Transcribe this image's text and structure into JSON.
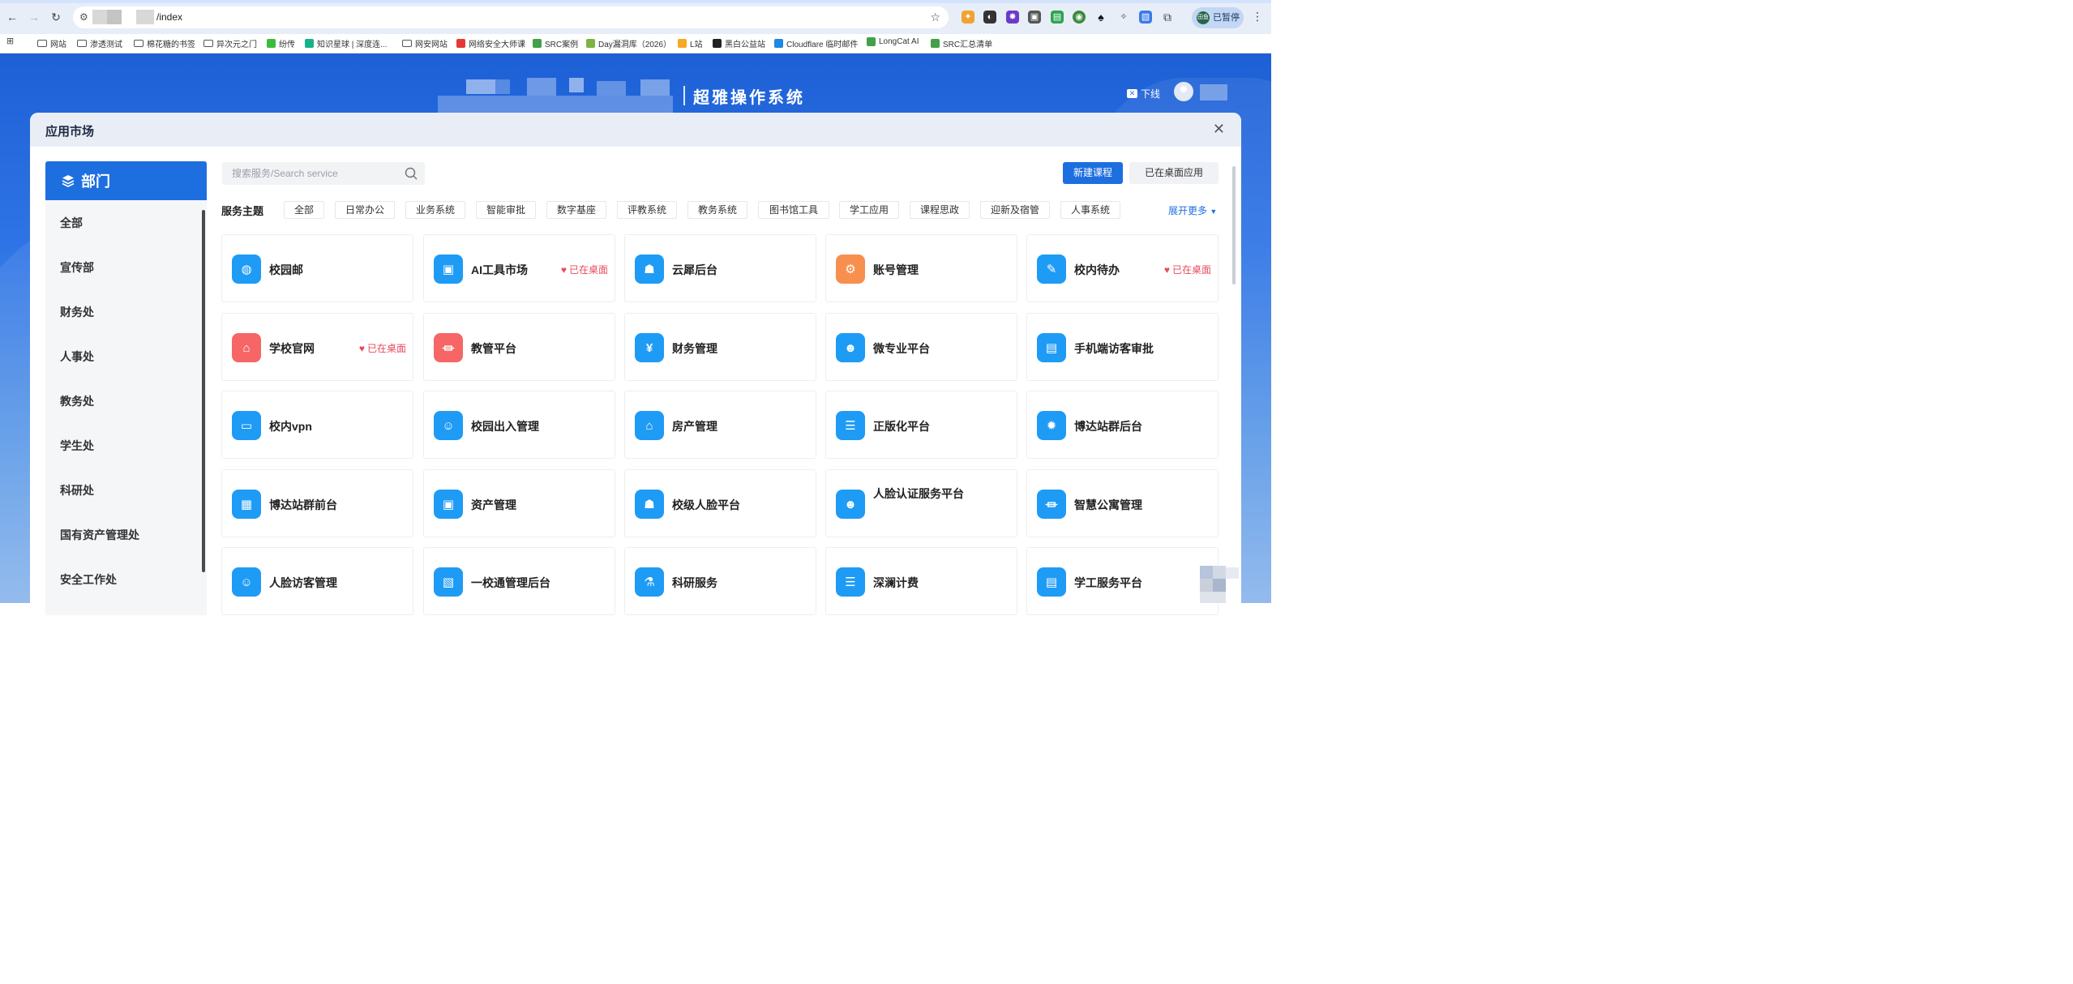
{
  "browser": {
    "url": "/index",
    "bookmarks": [
      {
        "label": "网站",
        "kind": "folder"
      },
      {
        "label": "渗透测试",
        "kind": "folder"
      },
      {
        "label": "棉花糖的书签",
        "kind": "folder"
      },
      {
        "label": "异次元之门",
        "kind": "folder"
      },
      {
        "label": "纷传",
        "kind": "site",
        "color": "#3dbb3d"
      },
      {
        "label": "知识星球 | 深度连...",
        "kind": "site",
        "color": "#16b28a"
      },
      {
        "label": "网安网站",
        "kind": "folder"
      },
      {
        "label": "网络安全大师课",
        "kind": "site",
        "color": "#e53935"
      },
      {
        "label": "SRC案例",
        "kind": "site",
        "color": "#43a047"
      },
      {
        "label": "Day漏洞库（2026）",
        "kind": "site",
        "color": "#7cb342"
      },
      {
        "label": "L站",
        "kind": "site",
        "color": "#f9a825"
      },
      {
        "label": "黑白公益站",
        "kind": "site",
        "color": "#222222"
      },
      {
        "label": "Cloudflare 临时邮件",
        "kind": "site",
        "color": "#1e88e5"
      },
      {
        "label": "LongCat AI",
        "kind": "site",
        "color": "#43a047"
      },
      {
        "label": "SRC汇总清单",
        "kind": "site",
        "color": "#43a047"
      }
    ],
    "profile_status": "已暂停",
    "profile_initials": "田鱼"
  },
  "header": {
    "system_title": "超雅操作系统",
    "logout_label": "下线"
  },
  "modal": {
    "title": "应用市场",
    "close_label": "✕"
  },
  "departments": {
    "title": "部门",
    "items": [
      "全部",
      "宣传部",
      "财务处",
      "人事处",
      "教务处",
      "学生处",
      "科研处",
      "国有资产管理处",
      "安全工作处"
    ]
  },
  "search": {
    "placeholder": "搜索服务/Search service"
  },
  "actions": {
    "new_course": "新建课程",
    "desktop_apps": "已在桌面应用"
  },
  "themes": {
    "label": "服务主题",
    "tags": [
      "全部",
      "日常办公",
      "业务系统",
      "智能审批",
      "数字基座",
      "评教系统",
      "教务系统",
      "图书馆工具",
      "学工应用",
      "课程思政",
      "迎新及宿管",
      "人事系统"
    ],
    "expand_label": "展开更多"
  },
  "desktop_badge": "已在桌面",
  "apps": [
    {
      "name": "校园邮",
      "icon": "globe-icon",
      "glyph": "◍",
      "color": "blue",
      "on_desktop": false
    },
    {
      "name": "AI工具市场",
      "icon": "toolbox-icon",
      "glyph": "▣",
      "color": "blue",
      "on_desktop": true
    },
    {
      "name": "云犀后台",
      "icon": "robot-icon",
      "glyph": "☗",
      "color": "blue",
      "on_desktop": false
    },
    {
      "name": "账号管理",
      "icon": "account-gear-icon",
      "glyph": "⚙",
      "color": "orange",
      "on_desktop": false
    },
    {
      "name": "校内待办",
      "icon": "todo-edit-icon",
      "glyph": "✎",
      "color": "blue",
      "on_desktop": true
    },
    {
      "name": "学校官网",
      "icon": "home-icon",
      "glyph": "⌂",
      "color": "red",
      "on_desktop": true
    },
    {
      "name": "教管平台",
      "icon": "institution-icon",
      "glyph": "⏛",
      "color": "red",
      "on_desktop": false
    },
    {
      "name": "财务管理",
      "icon": "money-bag-icon",
      "glyph": "¥",
      "color": "blue",
      "on_desktop": false
    },
    {
      "name": "微专业平台",
      "icon": "user-desk-icon",
      "glyph": "☻",
      "color": "blue",
      "on_desktop": false
    },
    {
      "name": "手机端访客审批",
      "icon": "document-icon",
      "glyph": "▤",
      "color": "blue",
      "on_desktop": false
    },
    {
      "name": "校内vpn",
      "icon": "monitor-icon",
      "glyph": "▭",
      "color": "blue",
      "on_desktop": false
    },
    {
      "name": "校园出入管理",
      "icon": "user-icon",
      "glyph": "☺",
      "color": "blue",
      "on_desktop": false
    },
    {
      "name": "房产管理",
      "icon": "house-icon",
      "glyph": "⌂",
      "color": "blue",
      "on_desktop": false
    },
    {
      "name": "正版化平台",
      "icon": "stack-icon",
      "glyph": "☰",
      "color": "blue",
      "on_desktop": false
    },
    {
      "name": "博达站群后台",
      "icon": "gear-icon",
      "glyph": "✹",
      "color": "blue",
      "on_desktop": false
    },
    {
      "name": "博达站群前台",
      "icon": "building-icon",
      "glyph": "▦",
      "color": "blue",
      "on_desktop": false
    },
    {
      "name": "资产管理",
      "icon": "screen-icon",
      "glyph": "▣",
      "color": "blue",
      "on_desktop": false
    },
    {
      "name": "校级人脸平台",
      "icon": "graduate-icon",
      "glyph": "☗",
      "color": "blue",
      "on_desktop": false
    },
    {
      "name": "人脸认证服务平台",
      "icon": "face-user-icon",
      "glyph": "☻",
      "color": "blue",
      "on_desktop": false
    },
    {
      "name": "智慧公寓管理",
      "icon": "bank-icon",
      "glyph": "⏛",
      "color": "blue",
      "on_desktop": false
    },
    {
      "name": "人脸访客管理",
      "icon": "visitor-icon",
      "glyph": "☺",
      "color": "blue",
      "on_desktop": false
    },
    {
      "name": "一校通管理后台",
      "icon": "presentation-icon",
      "glyph": "▧",
      "color": "blue",
      "on_desktop": false
    },
    {
      "name": "科研服务",
      "icon": "flask-icon",
      "glyph": "⚗",
      "color": "blue",
      "on_desktop": false
    },
    {
      "name": "深澜计费",
      "icon": "printer-icon",
      "glyph": "☰",
      "color": "blue",
      "on_desktop": false
    },
    {
      "name": "学工服务平台",
      "icon": "id-card-icon",
      "glyph": "▤",
      "color": "blue",
      "on_desktop": false
    }
  ]
}
